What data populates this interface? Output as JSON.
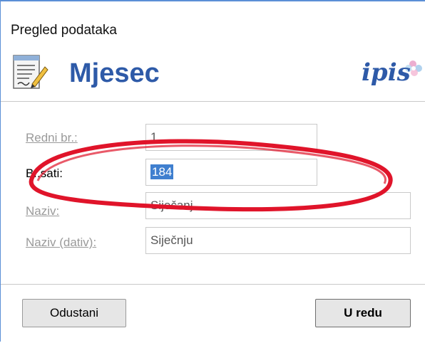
{
  "window": {
    "title": "Pregled podataka"
  },
  "header": {
    "heading": "Mjesec",
    "logo_text": "ipis"
  },
  "form": {
    "fields": [
      {
        "label": "Redni br.:",
        "value": "1"
      },
      {
        "label": "Br.sati:",
        "value": "184"
      },
      {
        "label": "Naziv:",
        "value": "Siječanj"
      },
      {
        "label": "Naziv (dativ):",
        "value": "Siječnju"
      }
    ]
  },
  "buttons": {
    "cancel": "Odustani",
    "ok": "U redu"
  },
  "colors": {
    "accent": "#2e5aa8",
    "selection": "#3f7fcf",
    "annotation": "#e0142a"
  }
}
